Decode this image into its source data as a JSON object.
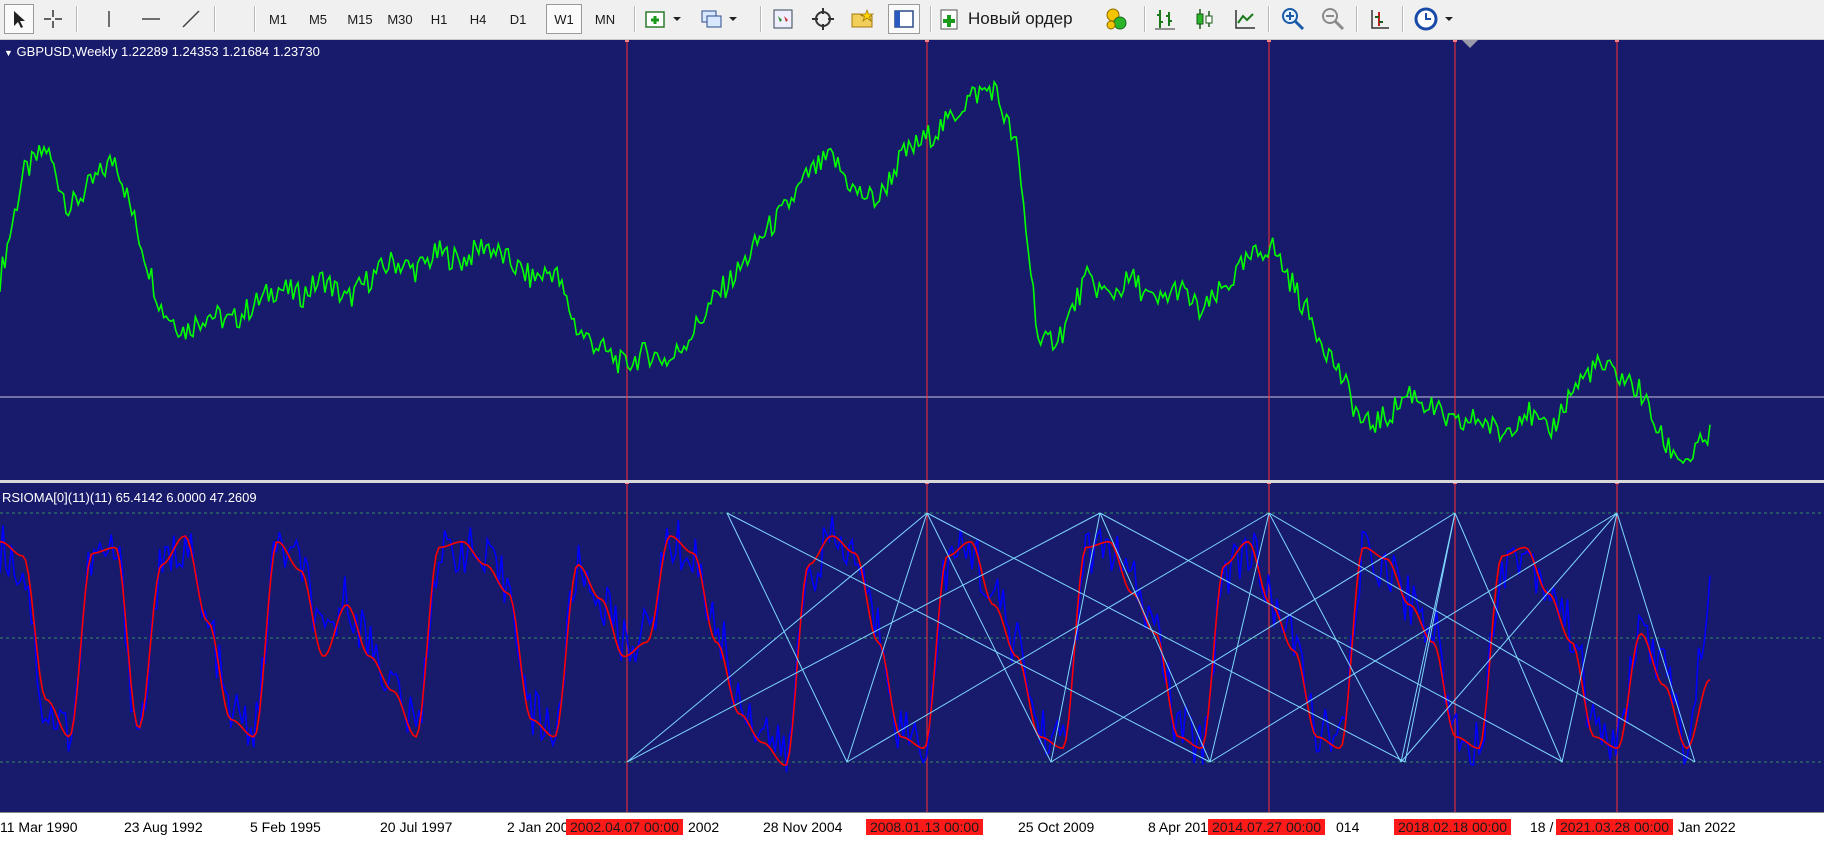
{
  "toolbar": {
    "timeframes": [
      "M1",
      "M5",
      "M15",
      "M30",
      "H1",
      "H4",
      "D1",
      "W1",
      "MN"
    ],
    "active_timeframe": "W1",
    "new_order_label": "Новый ордер"
  },
  "main_chart": {
    "title": "GBPUSD,Weekly  1.22289 1.24353 1.21684 1.23730",
    "line_color": "#00ff00",
    "background_color": "#181a6b"
  },
  "indicator": {
    "title": "RSIOMA[0](11)(11) 65.4142 6.0000 47.2609",
    "rsi_color": "#0000ff",
    "ma_color": "#ff0000",
    "fan_color": "#7fd7ff"
  },
  "x_axis": {
    "labels": [
      "11 Mar 1990",
      "23 Aug 1992",
      "5 Feb 1995",
      "20 Jul 1997",
      "2 Jan 200",
      "2002",
      "28 Nov 2004",
      "25 Oct 2009",
      "8 Apr 201",
      "014",
      "18 /",
      "Jan 2022"
    ],
    "highlighted_labels": [
      "2002.04.07 00:00",
      "2008.01.13 00:00",
      "2014.07.27 00:00",
      "2018.02.18 00:00",
      "2021.03.28 00:00"
    ]
  },
  "chart_data": {
    "type": "line",
    "series": [
      {
        "values": [
          1.62,
          1.86,
          1.92,
          1.78,
          1.84,
          1.9,
          1.72,
          1.55,
          1.5,
          1.54,
          1.52,
          1.56,
          1.6,
          1.58,
          1.62,
          1.57,
          1.62,
          1.66,
          1.64,
          1.68,
          1.66,
          1.7,
          1.66,
          1.62,
          1.64,
          1.5,
          1.46,
          1.42,
          1.45,
          1.43,
          1.5,
          1.58,
          1.64,
          1.72,
          1.78,
          1.86,
          1.9,
          1.82,
          1.8,
          1.9,
          1.94,
          1.98,
          2.04,
          2.06,
          1.92,
          1.46,
          1.5,
          1.62,
          1.58,
          1.62,
          1.56,
          1.6,
          1.54,
          1.6,
          1.66,
          1.7,
          1.6,
          1.5,
          1.4,
          1.28,
          1.3,
          1.36,
          1.32,
          1.28,
          1.3,
          1.26,
          1.32,
          1.26,
          1.36,
          1.42,
          1.4,
          1.36,
          1.24,
          1.2,
          1.26
        ]
      },
      {
        "name": "RSIOMA",
        "values": [
          88,
          80,
          30,
          25,
          84,
          86,
          25,
          80,
          90,
          60,
          30,
          25,
          88,
          82,
          55,
          70,
          55,
          40,
          25,
          85,
          88,
          82,
          75,
          30,
          25,
          80,
          70,
          55,
          58,
          90,
          85,
          60,
          35,
          25,
          15,
          80,
          90,
          85,
          60,
          25,
          20,
          82,
          88,
          70,
          55,
          25,
          20,
          85,
          88,
          75,
          60,
          25,
          20,
          80,
          88,
          70,
          55,
          25,
          20,
          85,
          82,
          70,
          60,
          25,
          20,
          82,
          86,
          75,
          60,
          25,
          20,
          60,
          45,
          20,
          70
        ]
      },
      {
        "name": "MA",
        "values": [
          90,
          85,
          35,
          22,
          86,
          88,
          25,
          82,
          92,
          62,
          28,
          22,
          90,
          80,
          50,
          68,
          50,
          38,
          22,
          88,
          90,
          82,
          72,
          28,
          22,
          82,
          70,
          50,
          55,
          92,
          86,
          55,
          30,
          20,
          12,
          82,
          92,
          86,
          55,
          22,
          18,
          85,
          90,
          68,
          50,
          22,
          18,
          88,
          90,
          72,
          58,
          22,
          18,
          82,
          90,
          68,
          52,
          22,
          18,
          88,
          84,
          68,
          55,
          22,
          18,
          85,
          88,
          72,
          55,
          22,
          18,
          58,
          40,
          18,
          42
        ]
      }
    ]
  }
}
